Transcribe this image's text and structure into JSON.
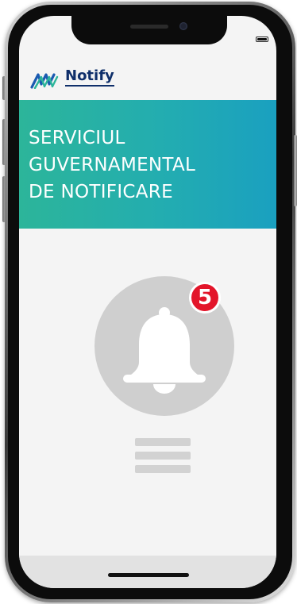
{
  "app": {
    "logo_text": "Notify"
  },
  "banner": {
    "lines": [
      "SERVICIUL",
      "GUVERNAMENTAL",
      "DE NOTIFICARE"
    ]
  },
  "notifications": {
    "badge_count": "5",
    "icon": "bell-icon"
  },
  "colors": {
    "banner_start": "#2cb59a",
    "banner_end": "#1aa0c0",
    "badge": "#e3152a",
    "logo": "#0f2f6a"
  }
}
